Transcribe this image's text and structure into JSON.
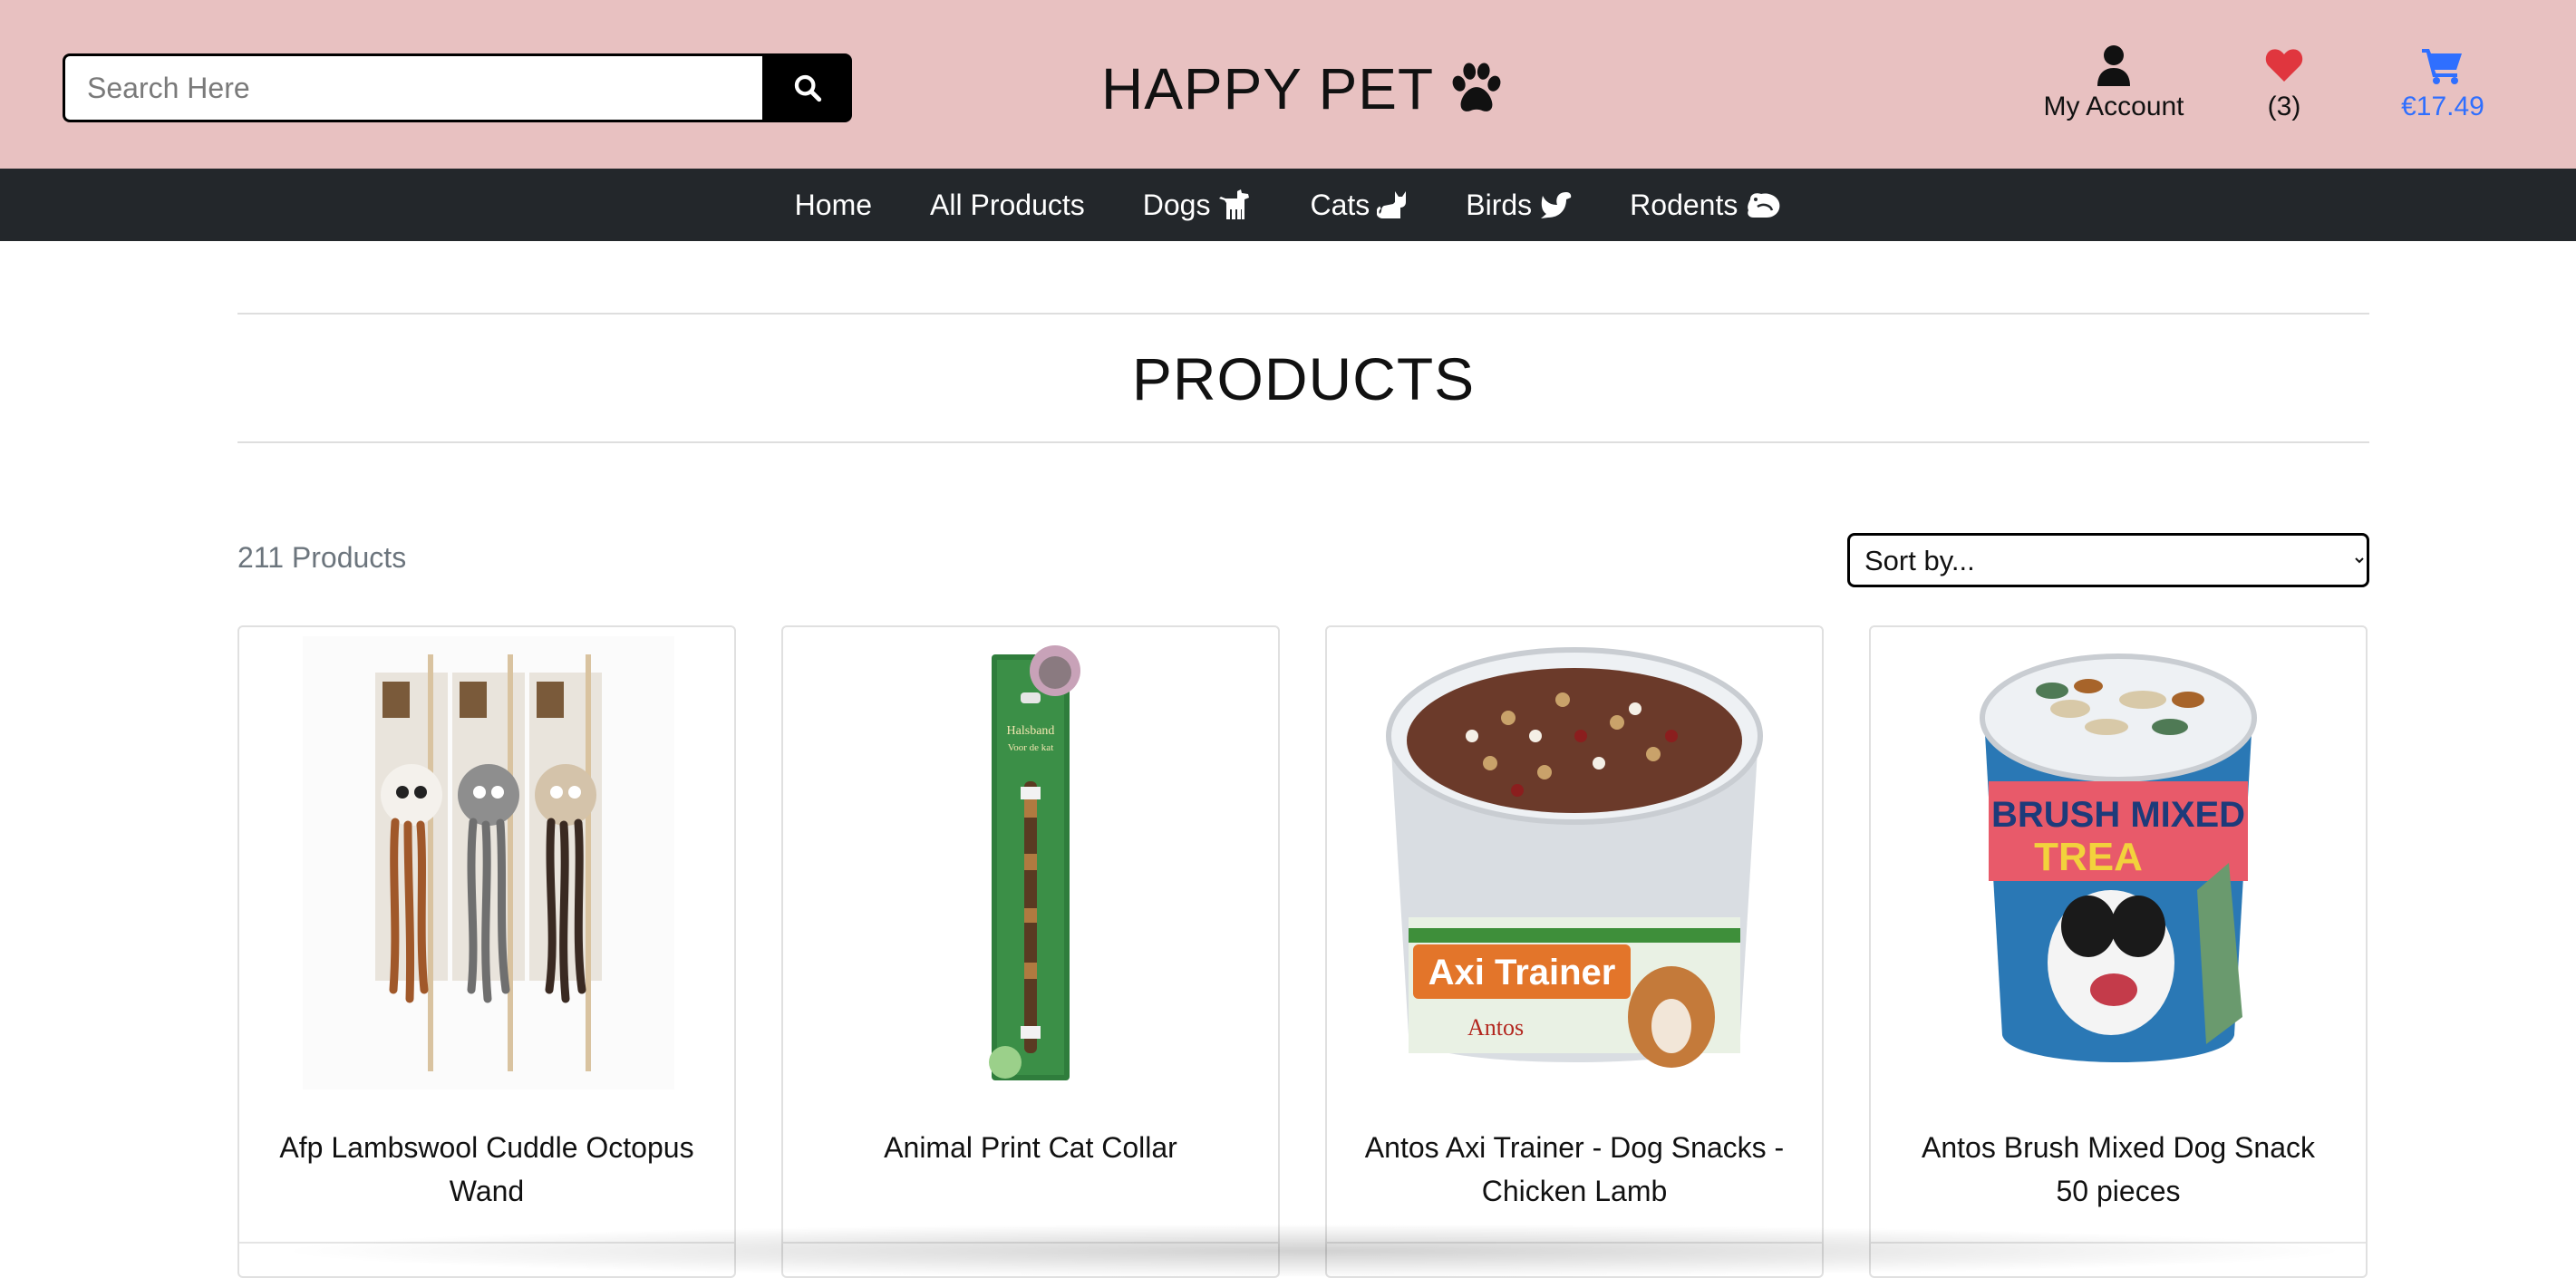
{
  "header": {
    "search": {
      "placeholder": "Search Here",
      "value": ""
    },
    "brand": "HAPPY PET",
    "account_label": "My Account",
    "wishlist_count": "(3)",
    "cart_total": "€17.49",
    "colors": {
      "topbar": "#e8c1c1",
      "wishlist": "#e0363e",
      "cart": "#2f6fff"
    }
  },
  "nav": {
    "items": [
      {
        "label": "Home",
        "icon": ""
      },
      {
        "label": "All Products",
        "icon": ""
      },
      {
        "label": "Dogs",
        "icon": "dog-icon"
      },
      {
        "label": "Cats",
        "icon": "cat-icon"
      },
      {
        "label": "Birds",
        "icon": "dove-icon"
      },
      {
        "label": "Rodents",
        "icon": "otter-icon"
      }
    ],
    "background": "#23272b"
  },
  "main": {
    "title": "PRODUCTS",
    "count": "211 Products",
    "sort": {
      "selected": "Sort by..."
    },
    "products": [
      {
        "name": "Afp Lambswool Cuddle Octopus Wand"
      },
      {
        "name": "Animal Print Cat Collar"
      },
      {
        "name": "Antos Axi Trainer - Dog Snacks - Chicken Lamb"
      },
      {
        "name": "Antos Brush Mixed Dog Snack 50 pieces"
      }
    ]
  }
}
